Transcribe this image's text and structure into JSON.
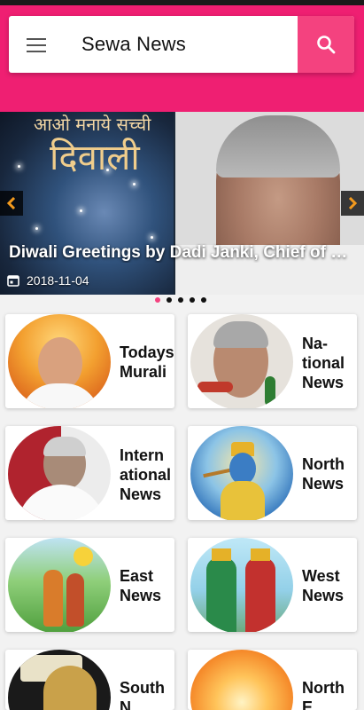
{
  "app": {
    "title": "Sewa News"
  },
  "header": {
    "menu_icon": "hamburger-menu-icon",
    "search_icon": "search-icon",
    "accent_color": "#ef1f72"
  },
  "carousel": {
    "slide_text_hindi_line1": "आओ मनाये सच्ची",
    "slide_text_hindi_line2": "दिवाली",
    "caption": "Diwali Greetings by Dadi Janki, Chief of Br...",
    "date": "2018-11-04",
    "dots_count": 5,
    "active_dot": 0
  },
  "categories": [
    {
      "label_line1": "Todays",
      "label_line2": "Murali",
      "label_line3": ""
    },
    {
      "label_line1": "Na-",
      "label_line2": "tional",
      "label_line3": "News"
    },
    {
      "label_line1": "Intern",
      "label_line2": "ational",
      "label_line3": "News"
    },
    {
      "label_line1": "North",
      "label_line2": "News",
      "label_line3": ""
    },
    {
      "label_line1": "East",
      "label_line2": "News",
      "label_line3": ""
    },
    {
      "label_line1": "West",
      "label_line2": "News",
      "label_line3": ""
    },
    {
      "label_line1": "South",
      "label_line2": "N...",
      "label_line3": ""
    },
    {
      "label_line1": "North",
      "label_line2": "E...",
      "label_line3": ""
    }
  ]
}
